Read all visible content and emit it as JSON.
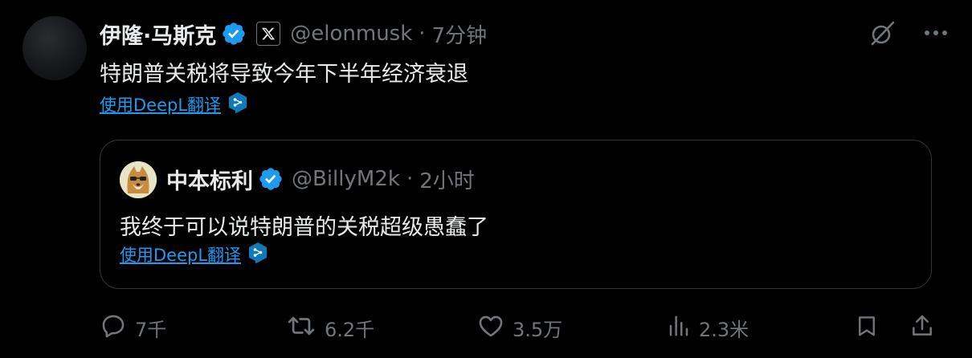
{
  "tweet": {
    "display_name": "伊隆·马斯克",
    "handle": "@elonmusk",
    "separator": "·",
    "time": "7分钟",
    "text": "特朗普关税将导致今年下半年经济衰退",
    "translate_label": "使用DeepL翻译"
  },
  "quote": {
    "display_name": "中本标利",
    "handle": "@BillyM2k",
    "separator": "·",
    "time": "2小时",
    "text": "我终于可以说特朗普的关税超级愚蠢了",
    "translate_label": "使用DeepL翻译"
  },
  "actions": {
    "replies": "7千",
    "retweets": "6.2千",
    "likes": "3.5万",
    "views": "2.3米"
  },
  "icons": {
    "verified": "verified-badge-icon",
    "x_badge": "x-logo-icon",
    "grok": "grok-icon",
    "more": "more-icon",
    "deepl": "deepl-icon",
    "reply": "reply-icon",
    "retweet": "retweet-icon",
    "like": "heart-icon",
    "views": "views-icon",
    "bookmark": "bookmark-icon",
    "share": "share-icon"
  },
  "colors": {
    "background": "#000000",
    "text_primary": "#e7e9ea",
    "text_secondary": "#71767b",
    "link": "#1d9bf0",
    "verified": "#1d9bf0",
    "deepl": "#0f7ab8",
    "border": "#333639"
  }
}
